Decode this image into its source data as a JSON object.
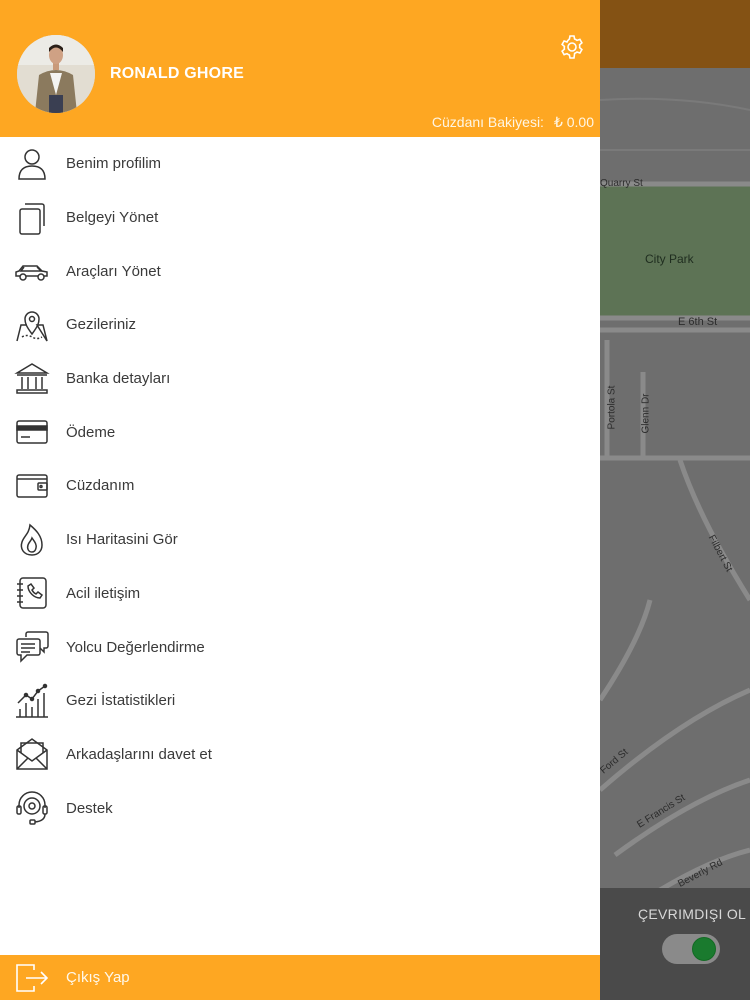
{
  "header": {
    "username": "RONALD GHORE",
    "wallet_label": "Cüzdanı Bakiyesi:",
    "wallet_value": "₺ 0.00"
  },
  "menu": [
    {
      "label": "Benim profilim",
      "icon": "user-icon"
    },
    {
      "label": "Belgeyi Yönet",
      "icon": "documents-icon"
    },
    {
      "label": "Araçları Yönet",
      "icon": "car-icon"
    },
    {
      "label": "Gezileriniz",
      "icon": "map-pin-icon"
    },
    {
      "label": "Banka detayları",
      "icon": "bank-icon"
    },
    {
      "label": "Ödeme",
      "icon": "credit-card-icon"
    },
    {
      "label": "Cüzdanım",
      "icon": "wallet-icon"
    },
    {
      "label": "Isı Haritasini Gör",
      "icon": "flame-icon"
    },
    {
      "label": "Acil iletişim",
      "icon": "phone-book-icon"
    },
    {
      "label": "Yolcu Değerlendirme",
      "icon": "chat-icon"
    },
    {
      "label": "Gezi İstatistikleri",
      "icon": "stats-chart-icon"
    },
    {
      "label": "Arkadaşlarını davet et",
      "icon": "envelope-icon"
    },
    {
      "label": "Destek",
      "icon": "headset-icon"
    }
  ],
  "footer": {
    "logout_label": "Çıkış Yap"
  },
  "map": {
    "streets": [
      "Quarry St",
      "City Park",
      "E 6th St",
      "Portola St",
      "Glenn Dr",
      "Filbert St",
      "Ford St",
      "E Francis St",
      "Beverly Rd"
    ],
    "offline_label": "ÇEVRIMDIŞI OL"
  },
  "colors": {
    "accent": "#fea722",
    "toggle_knob": "#1a7a2e"
  }
}
